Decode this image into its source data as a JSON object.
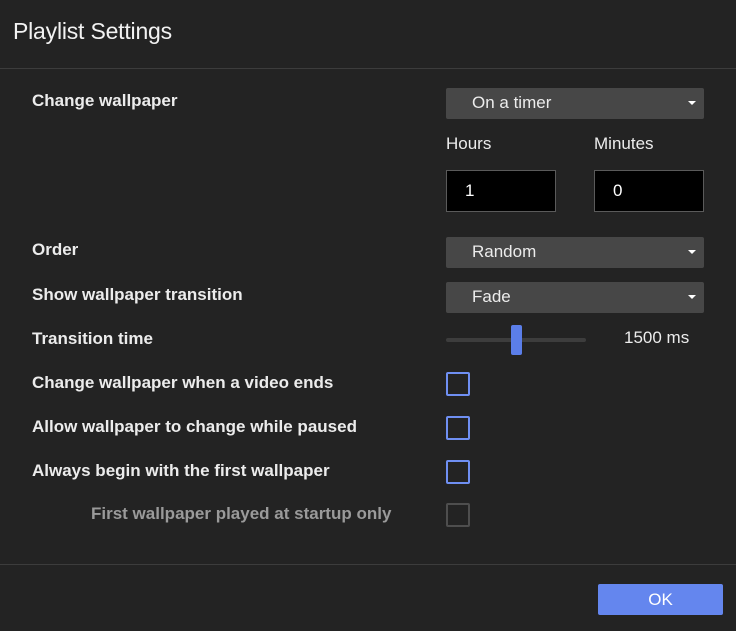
{
  "dialog": {
    "title": "Playlist Settings"
  },
  "settings": {
    "change_wallpaper": {
      "label": "Change wallpaper",
      "value": "On a timer"
    },
    "hours": {
      "label": "Hours",
      "value": "1"
    },
    "minutes": {
      "label": "Minutes",
      "value": "0"
    },
    "order": {
      "label": "Order",
      "value": "Random"
    },
    "transition": {
      "label": "Show wallpaper transition",
      "value": "Fade"
    },
    "transition_time": {
      "label": "Transition time",
      "value_text": "1500 ms",
      "slider_fraction": 0.5
    },
    "video_ends": {
      "label": "Change wallpaper when a video ends",
      "checked": false
    },
    "while_paused": {
      "label": "Allow wallpaper to change while paused",
      "checked": false
    },
    "first_wallpaper": {
      "label": "Always begin with the first wallpaper",
      "checked": false
    },
    "startup_only": {
      "label": "First wallpaper played at startup only",
      "checked": false,
      "disabled": true
    }
  },
  "footer": {
    "ok_label": "OK"
  },
  "colors": {
    "background": "#232323",
    "accent": "#6486ee",
    "select_bg": "#474747",
    "input_bg": "#000000"
  },
  "icons": {
    "dropdown": "caret-down-icon"
  }
}
